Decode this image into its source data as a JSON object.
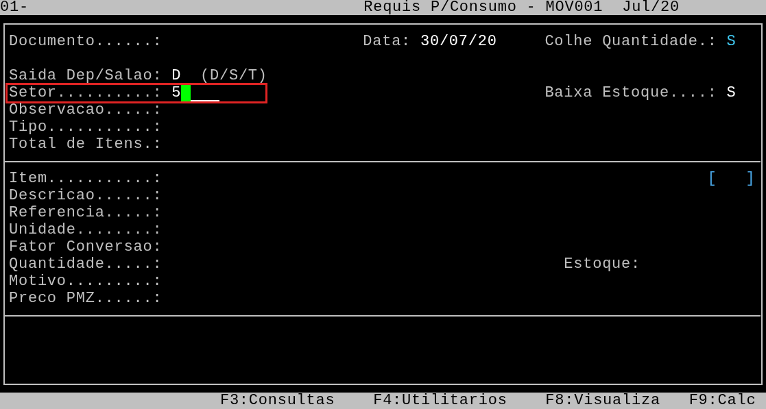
{
  "header": {
    "left": "01-",
    "title": "Requis P/Consumo - MOV001  Jul/20"
  },
  "header_fields": [
    {
      "label": "Documento......:"
    },
    {
      "label": "Data:",
      "value": "30/07/20",
      "color": "#ffffff"
    },
    {
      "label": "Colhe Quantidade.:",
      "value": "S",
      "color": "#40c8f0"
    },
    {
      "label": "Saida Dep/Salao:",
      "value": "D",
      "color": "#ffffff",
      "note": "(D/S/T)"
    },
    {
      "label": "Setor..........:",
      "value": "5",
      "focused": true
    },
    {
      "label": "Baixa Estoque....:",
      "value": "S",
      "color": "#ffffff"
    },
    {
      "label": "Observacao.....:"
    },
    {
      "label": "Tipo...........:"
    },
    {
      "label": "Total de Itens.:"
    }
  ],
  "item_fields": [
    {
      "label": "Item...........:"
    },
    {
      "label": "Descricao......:"
    },
    {
      "label": "Referencia.....:"
    },
    {
      "label": "Unidade........:"
    },
    {
      "label": "Fator Conversao:"
    },
    {
      "label": "Quantidade.....:"
    },
    {
      "label": "Motivo.........:"
    },
    {
      "label": "Preco PMZ......:"
    }
  ],
  "item_indicator": "[   ]",
  "stock_label": "Estoque:",
  "function_keys": [
    "F3:Consultas",
    "F4:Utilitarios",
    "F8:Visualiza",
    "F9:Calc"
  ]
}
